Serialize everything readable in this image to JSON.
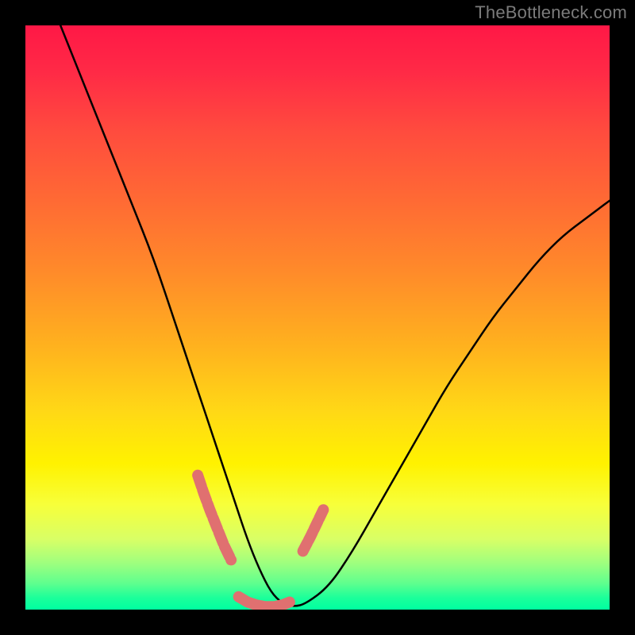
{
  "watermark": "TheBottleneck.com",
  "chart_data": {
    "type": "line",
    "title": "",
    "xlabel": "",
    "ylabel": "",
    "xlim": [
      0,
      100
    ],
    "ylim": [
      0,
      100
    ],
    "grid": false,
    "legend": false,
    "background": "rainbow-vertical-gradient",
    "series": [
      {
        "name": "bottleneck-curve",
        "x": [
          6,
          10,
          14,
          18,
          22,
          26,
          28,
          30,
          32,
          34,
          36,
          38,
          40,
          42,
          44,
          46,
          48,
          52,
          56,
          60,
          64,
          68,
          72,
          76,
          80,
          84,
          88,
          92,
          96,
          100
        ],
        "y": [
          100,
          90,
          80,
          70,
          60,
          48,
          42,
          36,
          30,
          24,
          18,
          12,
          7,
          3,
          1,
          0.5,
          1,
          4,
          10,
          17,
          24,
          31,
          38,
          44,
          50,
          55,
          60,
          64,
          67,
          70
        ]
      }
    ],
    "highlight_segments": [
      {
        "name": "left-bumps",
        "x": [
          29.5,
          30.5,
          31.6,
          32.8,
          34.0,
          35.2
        ],
        "y": [
          23.0,
          20.0,
          17.0,
          14.0,
          11.0,
          8.5
        ]
      },
      {
        "name": "bottom-bumps",
        "x": [
          36.5,
          38.0,
          39.5,
          41.0,
          42.5,
          44.0,
          45.5
        ],
        "y": [
          2.2,
          1.3,
          0.8,
          0.5,
          0.5,
          0.8,
          1.4
        ]
      },
      {
        "name": "right-bumps",
        "x": [
          47.5,
          48.8,
          50.0,
          51.2
        ],
        "y": [
          10.0,
          12.5,
          15.0,
          17.5
        ]
      }
    ]
  }
}
